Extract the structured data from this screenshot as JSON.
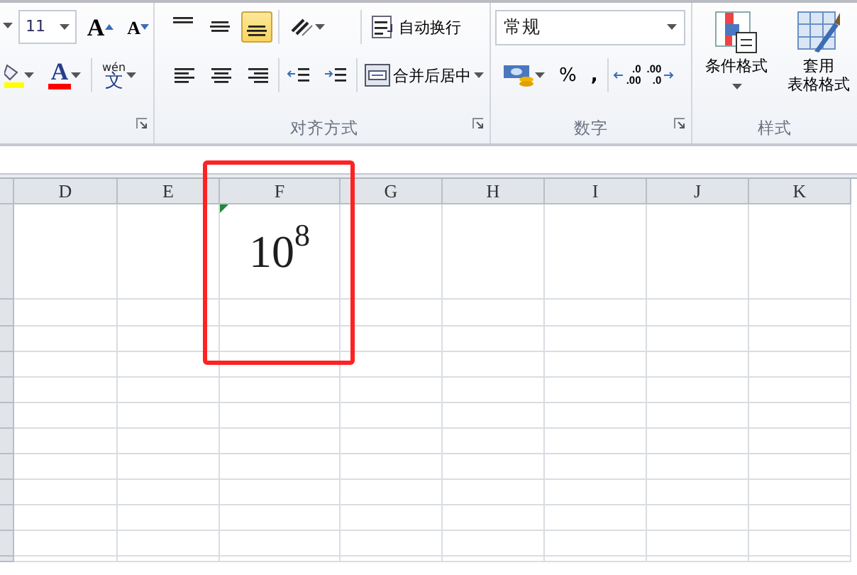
{
  "ribbon": {
    "font_group": {
      "font_size": "11",
      "grow_font": "A",
      "shrink_font": "A",
      "font_color": "A",
      "phonetic_top": "wén",
      "phonetic_bottom": "文"
    },
    "alignment_group": {
      "label": "对齐方式",
      "vertical_align": [
        {
          "kind": "top",
          "selected": false
        },
        {
          "kind": "middle",
          "selected": false
        },
        {
          "kind": "bottom",
          "selected": true
        }
      ],
      "wrap_text": "自动换行",
      "merge_center": "合并后居中"
    },
    "number_group": {
      "label": "数字",
      "format": "常规",
      "percent": "%",
      "comma": ",",
      "decimal_buttons": [
        {
          "top": ".0",
          "bottom": ".00",
          "kind": "increase"
        },
        {
          "top": ".00",
          "bottom": ".0",
          "kind": "decrease"
        }
      ]
    },
    "styles_group": {
      "label": "样式",
      "conditional_format": "条件格式",
      "table_format": [
        "套用",
        "表格格式"
      ]
    }
  },
  "sheet": {
    "columns": [
      "D",
      "E",
      "F",
      "G",
      "H",
      "I",
      "J",
      "K"
    ],
    "rows": [
      {
        "cells": [
          {},
          {},
          {
            "value": "10$^{8}$",
            "indicator": true,
            "outlined": true
          },
          {},
          {},
          {},
          {},
          {}
        ]
      }
    ]
  }
}
